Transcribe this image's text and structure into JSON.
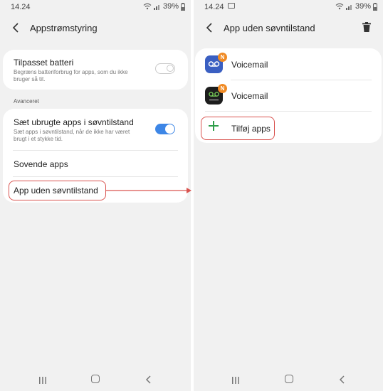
{
  "status": {
    "time": "14.24",
    "battery": "39%"
  },
  "left": {
    "title": "Appstrømstyring",
    "adaptive_battery": {
      "title": "Tilpasset batteri",
      "subtitle_line1": "Begræns batteriforbrug for apps, som du ikke",
      "subtitle_line2": "bruger så tit.",
      "toggle_on": false
    },
    "section_label": "Avanceret",
    "put_to_sleep": {
      "title": "Sæt ubrugte apps i søvntilstand",
      "subtitle_line1": "Sæt apps i søvntilstand, når de ikke har været",
      "subtitle_line2": "brugt i et stykke tid.",
      "toggle_on": true
    },
    "sleeping_apps": "Sovende apps",
    "never_sleeping": "App uden søvntilstand"
  },
  "right": {
    "title": "App uden søvntilstand",
    "apps": [
      {
        "name": "Voicemail",
        "icon": "voicemail-app-icon-blue",
        "badge": "N"
      },
      {
        "name": "Voicemail",
        "icon": "voicemail-app-icon-dark",
        "badge": "N"
      }
    ],
    "add_apps": "Tilføj apps"
  },
  "colors": {
    "toggle_on": "#3d86e6",
    "highlight": "#d9534f",
    "add_plus": "#2e9e4a",
    "badge": "#f08a24"
  }
}
